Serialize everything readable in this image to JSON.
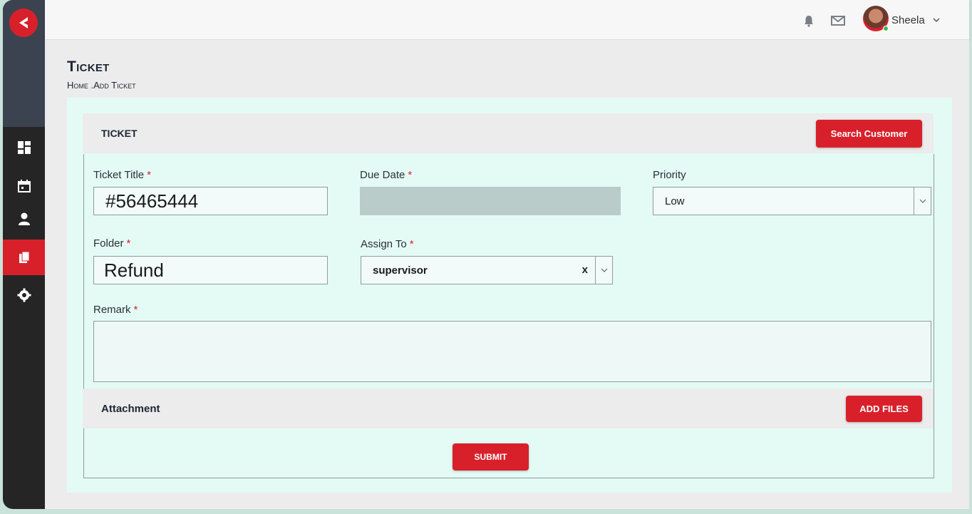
{
  "sidebar": {
    "logo_icon": "brand-logo-icon",
    "items": [
      {
        "name": "dashboard",
        "icon": "dashboard-icon",
        "active": false
      },
      {
        "name": "calendar",
        "icon": "calendar-icon",
        "active": false
      },
      {
        "name": "users",
        "icon": "user-icon",
        "active": false
      },
      {
        "name": "tickets",
        "icon": "clipboard-icon",
        "active": true
      },
      {
        "name": "settings",
        "icon": "gear-icon",
        "active": false
      }
    ]
  },
  "topbar": {
    "notification_icon": "bell-icon",
    "mail_icon": "mail-icon",
    "user_name": "Sheela"
  },
  "page": {
    "title": "Ticket",
    "breadcrumb": "Home .Add Ticket"
  },
  "ticket_section": {
    "title": "TICKET",
    "search_customer_label": "Search Customer"
  },
  "form": {
    "ticket_title_label": "Ticket Title",
    "ticket_title_value": "#56465444",
    "due_date_label": "Due Date",
    "due_date_value": "",
    "priority_label": "Priority",
    "priority_value": "Low",
    "folder_label": "Folder",
    "folder_value": "Refund",
    "assign_to_label": "Assign To",
    "assign_to_value": "supervisor",
    "clear_symbol": "x",
    "remark_label": "Remark",
    "remark_value": "",
    "required_marker": "*"
  },
  "attachment_section": {
    "title": "Attachment",
    "add_files_label": "ADD FILES"
  },
  "submit_label": "SUBMIT",
  "colors": {
    "accent": "#d8202b",
    "sidebar": "#252525",
    "card_bg": "#e4fbf5"
  }
}
